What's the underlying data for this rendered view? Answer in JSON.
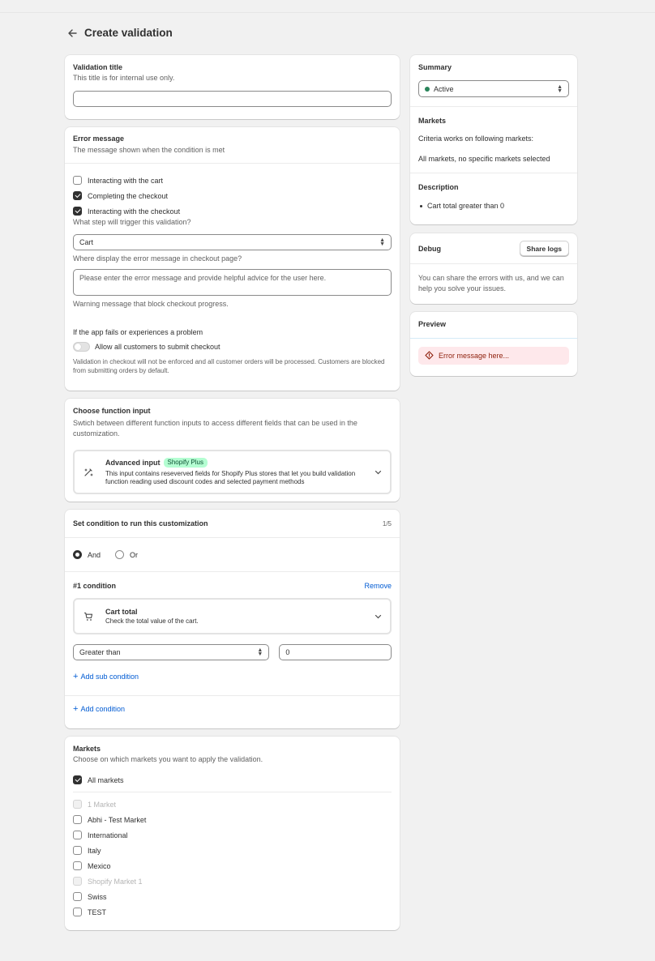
{
  "header": {
    "title": "Create validation"
  },
  "validation_title": {
    "heading": "Validation title",
    "subtitle": "This title is for internal use only.",
    "value": ""
  },
  "error_message": {
    "heading": "Error message",
    "subtitle": "The message shown when the condition is met",
    "triggers": [
      {
        "label": "Interacting with the cart",
        "checked": false
      },
      {
        "label": "Completing the checkout",
        "checked": true
      },
      {
        "label": "Interacting with the checkout",
        "checked": true
      }
    ],
    "trigger_question": "What step will trigger this validation?",
    "display_selected": "Cart",
    "display_question": "Where display the error message in checkout page?",
    "message_placeholder": "Please enter the error message and provide helpful advice for the user here.",
    "warning_help": "Warning message that block checkout progress.",
    "fail_heading": "If the app fails or experiences a problem",
    "fail_toggle_label": "Allow all customers to submit checkout",
    "fail_help": "Validation in checkout will not be enforced and all customer orders will be processed. Customers are blocked from submitting orders by default."
  },
  "function_input": {
    "heading": "Choose function input",
    "subtitle": "Swtich between different function inputs to access different fields that can be used in the customization.",
    "option_title": "Advanced input",
    "option_badge": "Shopify Plus",
    "option_description": "This input contains reseverved fields for Shopify Plus stores that let you build validation function reading used discount codes and selected payment methods"
  },
  "conditions": {
    "heading": "Set condition to run this customization",
    "count": "1/5",
    "logic_and": "And",
    "logic_or": "Or",
    "logic_selected": "And",
    "condition_label": "#1 condition",
    "remove_label": "Remove",
    "type_title": "Cart total",
    "type_description": "Check the total value of the cart.",
    "operator": "Greater than",
    "value": "0",
    "add_sub_label": "Add sub condition",
    "add_condition_label": "Add condition"
  },
  "markets": {
    "heading": "Markets",
    "subtitle": "Choose on which markets you want to apply the validation.",
    "all_label": "All markets",
    "all_checked": true,
    "items": [
      {
        "label": "1 Market",
        "disabled": true
      },
      {
        "label": "Abhi - Test Market",
        "disabled": false
      },
      {
        "label": "International",
        "disabled": false
      },
      {
        "label": "Italy",
        "disabled": false
      },
      {
        "label": "Mexico",
        "disabled": false
      },
      {
        "label": "Shopify Market 1",
        "disabled": true
      },
      {
        "label": "Swiss",
        "disabled": false
      },
      {
        "label": "TEST",
        "disabled": false
      }
    ]
  },
  "summary": {
    "heading": "Summary",
    "status": "Active",
    "markets_heading": "Markets",
    "markets_line1": "Criteria works on following markets:",
    "markets_line2": "All markets, no specific markets selected",
    "description_heading": "Description",
    "description_item": "Cart total greater than 0"
  },
  "debug": {
    "heading": "Debug",
    "button_label": "Share logs",
    "text": "You can share the errors with us, and we can help you solve your issues."
  },
  "preview": {
    "heading": "Preview",
    "error_text": "Error message here..."
  },
  "colors": {
    "accent_link": "#005bd3",
    "status_active": "#29845a",
    "badge_bg": "#b4fed2",
    "error_bg": "#fee8eb",
    "error_text": "#8e1f0b"
  }
}
